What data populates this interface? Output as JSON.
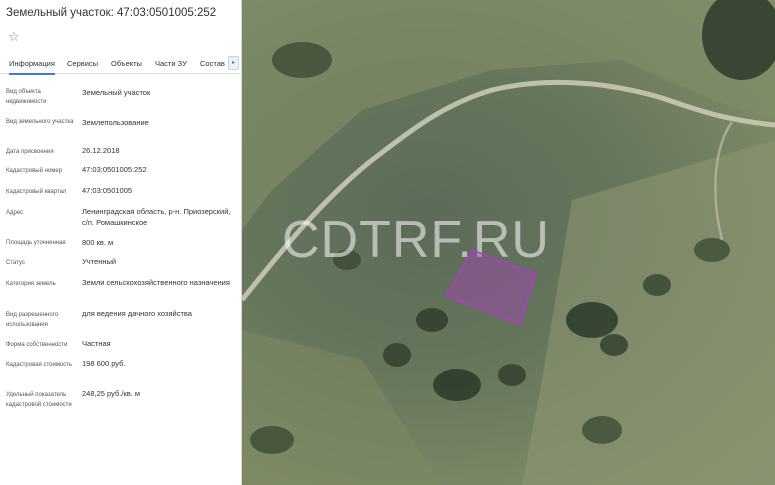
{
  "panel": {
    "title": "Земельный участок: 47:03:0501005:252",
    "star_icon": "☆",
    "tabs": [
      {
        "label": "Информация",
        "active": true
      },
      {
        "label": "Сервисы"
      },
      {
        "label": "Объекты"
      },
      {
        "label": "Части ЗУ"
      },
      {
        "label": "Состав"
      }
    ],
    "tabs_more_icon": "▸",
    "rows": [
      {
        "label": "Вид объекта недвижимости",
        "value": "Земельный участок"
      },
      {
        "label": "Вид земельного участка",
        "value": "Землепользование"
      },
      {
        "label": "Дата присвоения",
        "value": "26.12.2018"
      },
      {
        "label": "Кадастровый номер",
        "value": "47:03:0501005:252"
      },
      {
        "label": "Кадастровый квартал",
        "value": "47:03:0501005"
      },
      {
        "label": "Адрес",
        "value": "Ленинградская область, р-н. Приозерский, с/п. Ромашкинское"
      },
      {
        "label": "Площадь уточненная",
        "value": "800 кв. м"
      },
      {
        "label": "Статус",
        "value": "Учтенный"
      },
      {
        "label": "Категория земель",
        "value": "Земли сельскохозяйственного назначения"
      },
      {
        "label": "Вид разрешенного использования",
        "value": "для ведения дачного хозяйства"
      },
      {
        "label": "Форма собственности",
        "value": "Частная"
      },
      {
        "label": "Кадастровая стоимость",
        "value": "198 600 руб."
      },
      {
        "label": "Удельный показатель кадастровой стоимости",
        "value": "248,25 руб./кв. м"
      }
    ]
  },
  "map": {
    "watermark": "CDTRF.RU",
    "parcel_color": "#b03cc8"
  }
}
